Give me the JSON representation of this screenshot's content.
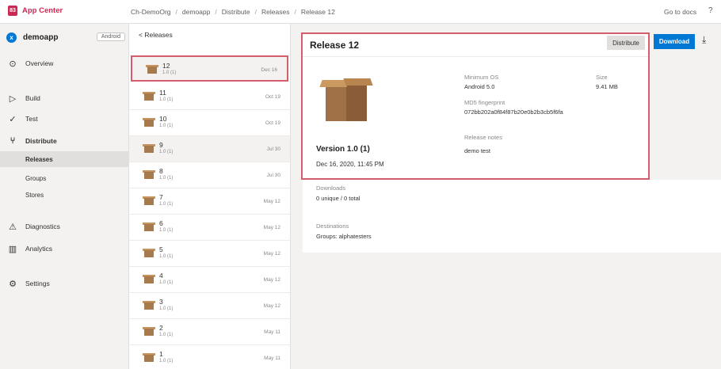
{
  "brand": {
    "logo": "83",
    "name": "App Center"
  },
  "breadcrumb": [
    "Ch-DemoOrg",
    "demoapp",
    "Distribute",
    "Releases",
    "Release 12"
  ],
  "breadcrumb_sep": "/",
  "topbar": {
    "go_to_docs": "Go to docs",
    "help": "?"
  },
  "app": {
    "icon": "x",
    "name": "demoapp",
    "os": "Android"
  },
  "nav": {
    "overview": "Overview",
    "build": "Build",
    "test": "Test",
    "distribute": "Distribute",
    "releases": "Releases",
    "groups": "Groups",
    "stores": "Stores",
    "diagnostics": "Diagnostics",
    "analytics": "Analytics",
    "settings": "Settings"
  },
  "list": {
    "header": "< Releases",
    "rows": [
      {
        "num": "12",
        "ver": "1.0 (1)",
        "date": "Dec 16"
      },
      {
        "num": "11",
        "ver": "1.0 (1)",
        "date": "Oct 19"
      },
      {
        "num": "10",
        "ver": "1.0 (1)",
        "date": "Oct 19"
      },
      {
        "num": "9",
        "ver": "1.0 (1)",
        "date": "Jul 30"
      },
      {
        "num": "8",
        "ver": "1.0 (1)",
        "date": "Jul 30"
      },
      {
        "num": "7",
        "ver": "1.0 (1)",
        "date": "May 12"
      },
      {
        "num": "6",
        "ver": "1.0 (1)",
        "date": "May 12"
      },
      {
        "num": "5",
        "ver": "1.0 (1)",
        "date": "May 12"
      },
      {
        "num": "4",
        "ver": "1.0 (1)",
        "date": "May 12"
      },
      {
        "num": "3",
        "ver": "1.0 (1)",
        "date": "May 12"
      },
      {
        "num": "2",
        "ver": "1.0 (1)",
        "date": "May 11"
      },
      {
        "num": "1",
        "ver": "1.0 (1)",
        "date": "May 11"
      }
    ]
  },
  "release": {
    "title": "Release 12",
    "distribute": "Distribute",
    "download": "Download",
    "version": "Version 1.0 (1)",
    "date": "Dec 16, 2020, 11:45 PM",
    "min_os_label": "Minimum OS",
    "min_os": "Android 5.0",
    "size_label": "Size",
    "size": "9.41 MB",
    "md5_label": "MD5 fingerprint",
    "md5": "072bb202a0f84f87b20e0b2b3cb5f6fa",
    "notes_label": "Release notes",
    "notes": "demo test"
  },
  "downloads": {
    "label": "Downloads",
    "value": "0 unique / 0 total"
  },
  "destinations": {
    "label": "Destinations",
    "value": "Groups: alphatesters"
  },
  "colors": {
    "brand": "#cc2955",
    "accent": "#0078d4",
    "highlight": "#d65d6b"
  }
}
